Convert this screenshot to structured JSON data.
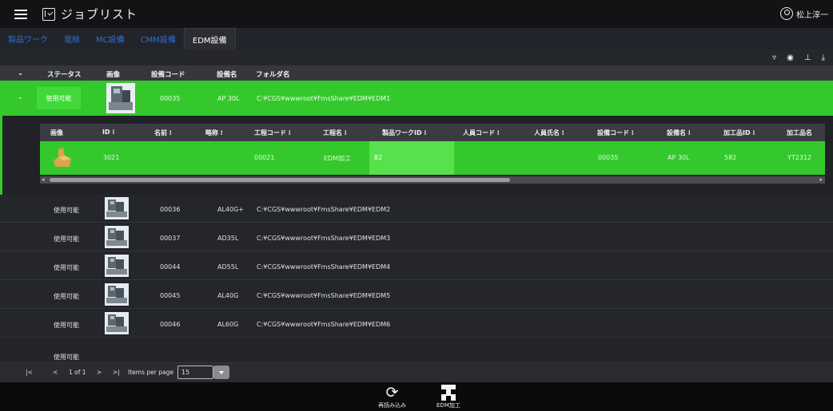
{
  "header": {
    "title": "ジョブリスト",
    "user_name": "松上淳一"
  },
  "tabs": [
    {
      "label": "製品ワーク",
      "active": false
    },
    {
      "label": "電極",
      "active": false
    },
    {
      "label": "MC設備",
      "active": false
    },
    {
      "label": "CMM設備",
      "active": false
    },
    {
      "label": "EDM設備",
      "active": true
    }
  ],
  "toolbar": {
    "filter_icon": "filter-icon",
    "eye_icon": "eye-icon",
    "pin_icon": "pin-icon",
    "download_icon": "download-icon"
  },
  "columns": {
    "expand": "⌄",
    "status": "ステータス",
    "image": "画像",
    "equipment_code": "設備コード",
    "equipment_name": "設備名",
    "folder_name": "フォルダ名"
  },
  "expanded_row": {
    "status": "使用可能",
    "code": "00035",
    "name": "AP 30L",
    "folder": "C:¥CGS¥wwwroot¥FmsShare¥EDM¥EDM1"
  },
  "nested_columns": [
    "画像",
    "ID  ⁝",
    "名前  ⁝",
    "略称  ⁝",
    "工程コード  ⁝",
    "工程名  ⁝",
    "製品ワークID  ⁝",
    "人員コード  ⁝",
    "人員氏名  ⁝",
    "設備コード  ⁝",
    "設備名  ⁝",
    "加工品ID  ⁝",
    "加工品名"
  ],
  "nested_row": {
    "id": "3021",
    "name": "",
    "short": "",
    "process_code": "00021",
    "process_name": "EDM加工",
    "product_work_id": "82",
    "staff_code": "",
    "staff_name": "",
    "equipment_code": "00035",
    "equipment_name": "AP 30L",
    "workpiece_id": "582",
    "workpiece_name": "YT2312"
  },
  "rows": [
    {
      "status": "使用可能",
      "code": "00036",
      "name": "AL40G+",
      "folder": "C:¥CGS¥wwwroot¥FmsShare¥EDM¥EDM2"
    },
    {
      "status": "使用可能",
      "code": "00037",
      "name": "AD35L",
      "folder": "C:¥CGS¥wwwroot¥FmsShare¥EDM¥EDM3"
    },
    {
      "status": "使用可能",
      "code": "00044",
      "name": "AD55L",
      "folder": "C:¥CGS¥wwwroot¥FmsShare¥EDM¥EDM4"
    },
    {
      "status": "使用可能",
      "code": "00045",
      "name": "AL40G",
      "folder": "C:¥CGS¥wwwroot¥FmsShare¥EDM¥EDM5"
    },
    {
      "status": "使用可能",
      "code": "00046",
      "name": "AL60G",
      "folder": "C:¥CGS¥wwwroot¥FmsShare¥EDM¥EDM6"
    }
  ],
  "paginator": {
    "first": "|<",
    "prev": "<",
    "range": "1 of 1",
    "next": ">",
    "last": ">|",
    "items_label": "Items per page",
    "page_size": "15"
  },
  "footer": {
    "reload_label": "再読み込み",
    "edm_label": "EDM加工"
  },
  "colors": {
    "accent_green": "#35c82d",
    "highlight_green": "#57e24d",
    "tab_blue": "#2f6fd0",
    "bg": "#22242b"
  }
}
